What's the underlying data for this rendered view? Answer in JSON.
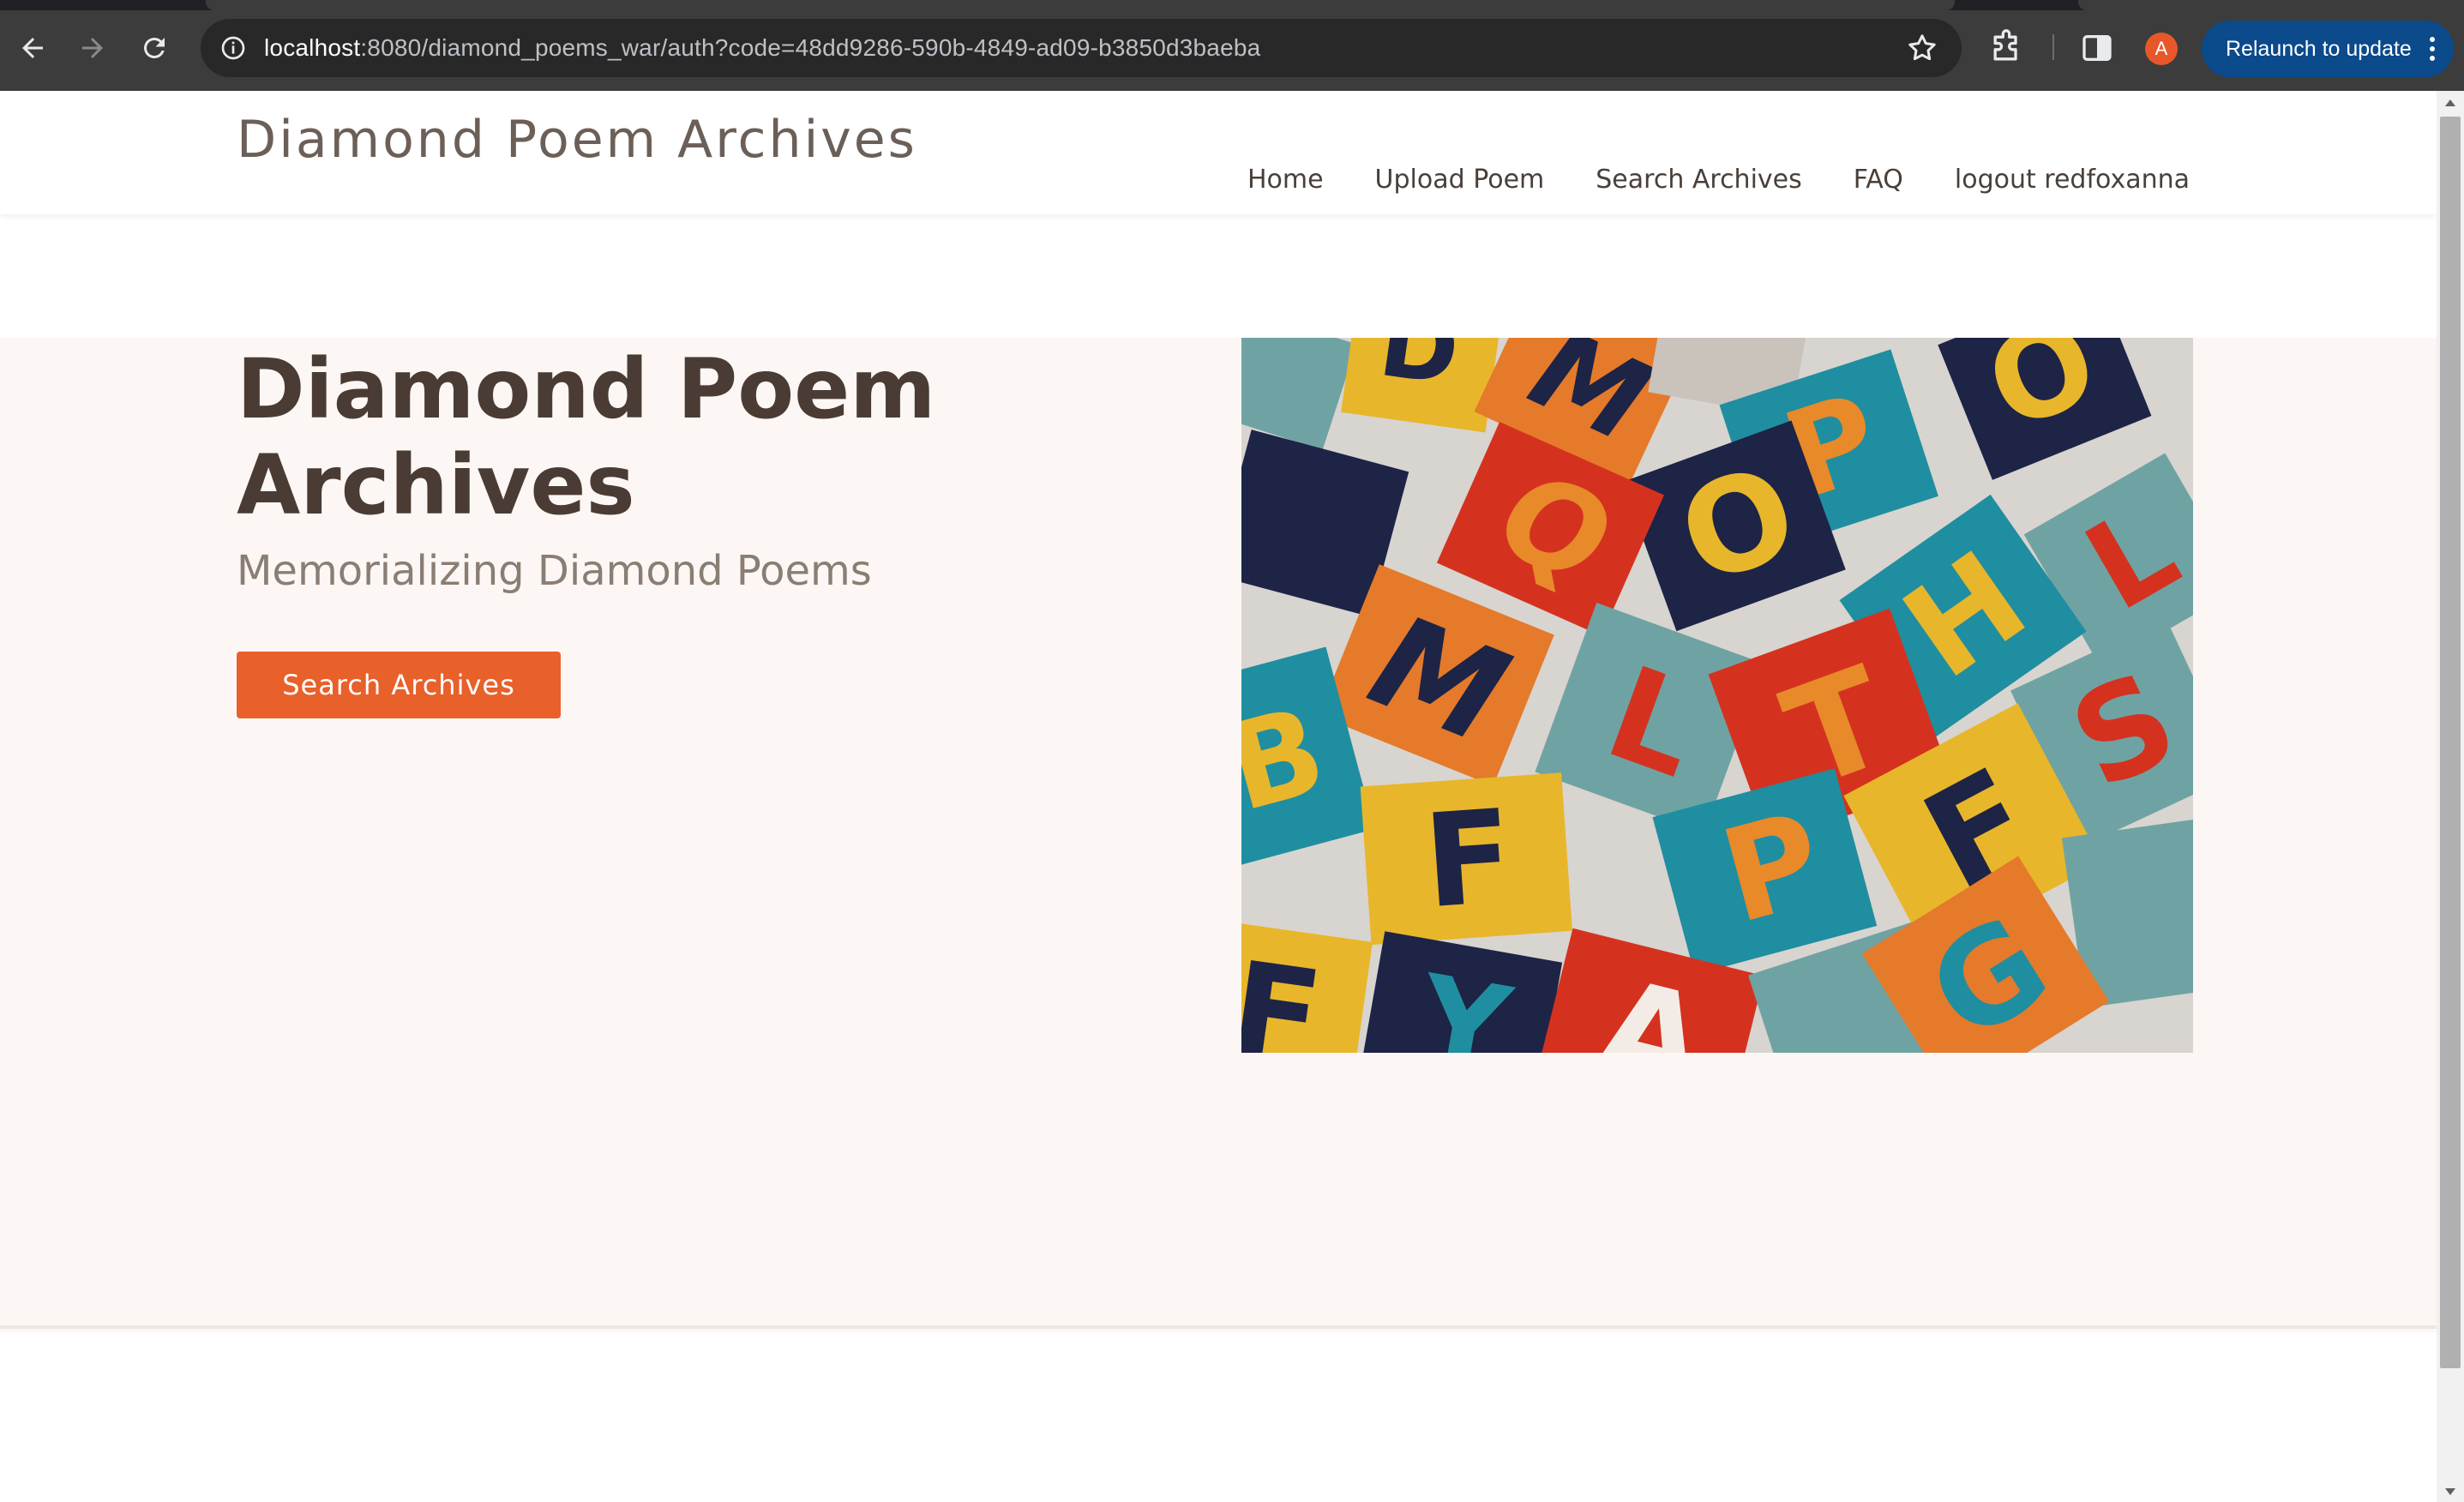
{
  "browser": {
    "url_host": "localhost",
    "url_rest": ":8080/diamond_poems_war/auth?code=48dd9286-590b-4849-ad09-b3850d3baeba",
    "avatar_letter": "A",
    "relaunch_label": "Relaunch to update"
  },
  "site": {
    "brand": "Diamond Poem Archives",
    "nav": [
      "Home",
      "Upload Poem",
      "Search Archives",
      "FAQ",
      "logout redfoxanna"
    ]
  },
  "hero": {
    "title": "Diamond Poem Archives",
    "subtitle": "Memorializing Diamond Poems",
    "button_label": "Search Archives",
    "image": "scattered colorful letter tiles"
  },
  "colors": {
    "accent": "#e8602a",
    "hero_bg": "#fcf7f4",
    "heading": "#4a3c34",
    "relaunch": "#0b4a8b"
  }
}
